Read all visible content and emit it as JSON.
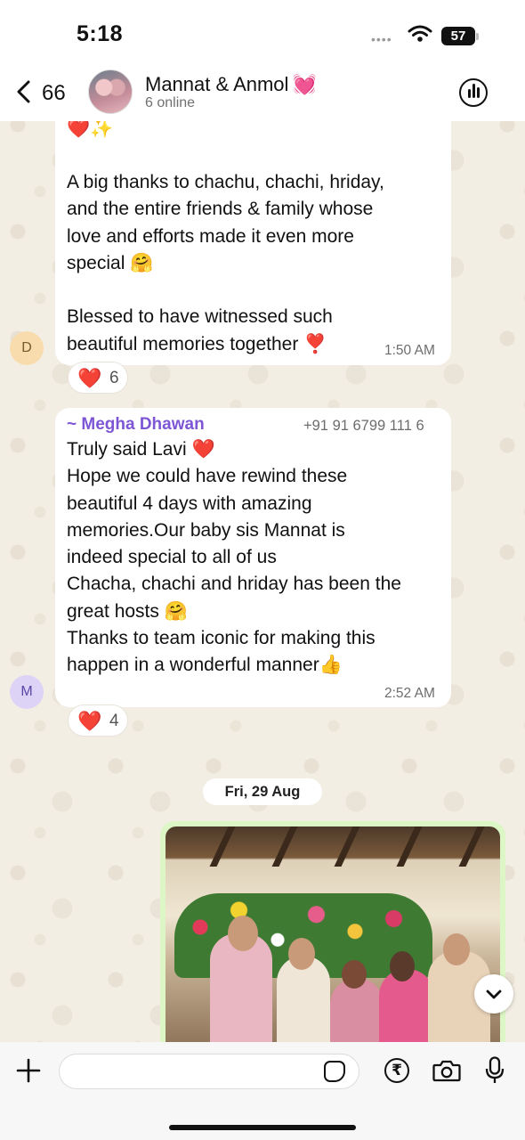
{
  "status_bar": {
    "time": "5:18",
    "battery": "57"
  },
  "header": {
    "back_count": "66",
    "group_name": "Mannat & Anmol",
    "group_emoji": "💓",
    "subtitle": "6 online",
    "icons": {
      "back": "chevron-left-icon",
      "call": "group-call-icon"
    }
  },
  "messages": [
    {
      "top_emoji": "❤️✨",
      "text": "A big thanks to chachu, chachi, hriday,\nand the entire friends & family whose\nlove and efforts made it even more\nspecial 🤗\n\nBlessed to have witnessed such\nbeautiful memories together ❣️",
      "time": "1:50 AM",
      "avatar_initial": "D",
      "reaction": {
        "emoji": "❤️",
        "count": "6"
      }
    },
    {
      "sender": "~ Megha Dhawan",
      "phone": "+91 91 6799 111 6",
      "text": "Truly said Lavi ❤️\nHope we could have rewind these\nbeautiful 4 days with amazing\nmemories.Our baby sis Mannat is\nindeed special to all of us\nChacha, chachi and hriday has been the\ngreat hosts 🤗\nThanks to team iconic for making this\nhappen in a wonderful manner👍",
      "time": "2:52 AM",
      "avatar_initial": "M",
      "reaction": {
        "emoji": "❤️",
        "count": "4"
      }
    }
  ],
  "date_separator": "Fri, 29 Aug",
  "composer": {
    "placeholder": "",
    "icons": [
      "plus-icon",
      "sticker-icon",
      "rupee-icon",
      "camera-icon",
      "microphone-icon"
    ]
  },
  "colors": {
    "sender_name": "#7d56d6",
    "outgoing_bubble": "#dcf7c5",
    "reaction_heart": "#e52b36"
  }
}
